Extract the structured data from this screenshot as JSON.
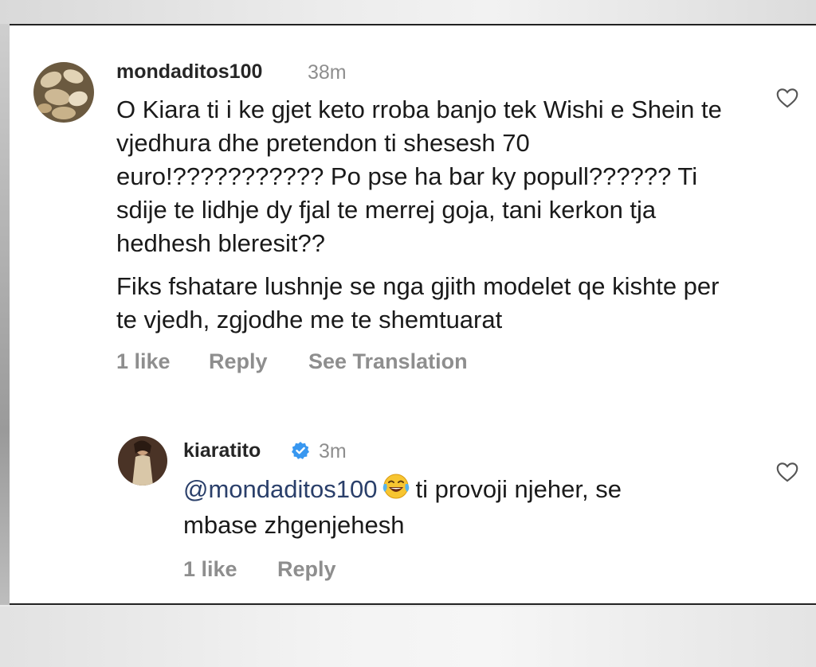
{
  "comment": {
    "username": "mondaditos100",
    "time": "38m",
    "paragraph1": "O Kiara ti i ke gjet keto rroba banjo tek Wishi e Shein te vjedhura dhe pretendon ti shesesh 70 euro!??????????? Po pse ha bar ky popull?????? Ti sdije te lidhje dy fjal te merrej goja, tani kerkon tja hedhesh bleresit??",
    "paragraph2": "Fiks fshatare lushnje se nga gjith modelet qe kishte per te vjedh, zgjodhe me te shemtuarat",
    "likes": "1 like",
    "reply_label": "Reply",
    "translation_label": "See Translation",
    "avatar_icon": "pastry-photo-avatar",
    "heart_icon": "heart-outline-icon"
  },
  "reply": {
    "username": "kiaratito",
    "verified_icon": "verified-badge-icon",
    "verified_color": "#3897f0",
    "time": "3m",
    "mention": "@mondaditos100",
    "emoji": "face-with-tears-of-joy-emoji",
    "text_after_emoji": "ti provoji njeher, se",
    "text_line2": "mbase zhgenjehesh",
    "likes": "1 like",
    "reply_label": "Reply",
    "avatar_icon": "profile-photo-avatar",
    "heart_icon": "heart-outline-icon"
  }
}
